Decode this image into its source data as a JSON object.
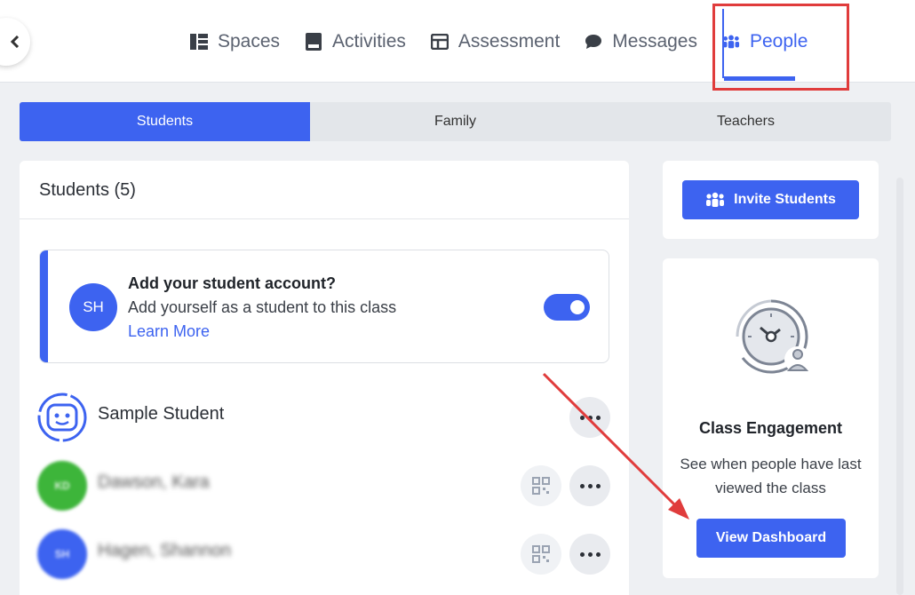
{
  "nav": {
    "items": [
      {
        "label": "Spaces",
        "icon": "spaces-icon"
      },
      {
        "label": "Activities",
        "icon": "activities-icon"
      },
      {
        "label": "Assessment",
        "icon": "assessment-icon"
      },
      {
        "label": "Messages",
        "icon": "messages-icon"
      },
      {
        "label": "People",
        "icon": "people-icon"
      }
    ],
    "active": "People"
  },
  "tabs": [
    {
      "label": "Students"
    },
    {
      "label": "Family"
    },
    {
      "label": "Teachers"
    }
  ],
  "students_card": {
    "title": "Students (5)",
    "add_account": {
      "avatar": "SH",
      "title": "Add your student account?",
      "subtitle": "Add yourself as a student to this class",
      "link": "Learn More",
      "toggle_on": true
    },
    "rows": [
      {
        "name": "Sample Student",
        "avatar": "robot-avatar"
      },
      {
        "name": "Dawson, Kara",
        "initials": "KD",
        "color": "#3db53a"
      },
      {
        "name": "Hagen, Shannon",
        "initials": "SH",
        "color": "#3d63f0"
      }
    ]
  },
  "invite": {
    "label": "Invite Students"
  },
  "engagement": {
    "title": "Class Engagement",
    "text": "See when people have last viewed the class",
    "button": "View Dashboard"
  },
  "colors": {
    "accent": "#3d63f0",
    "annotation": "#e03c3c"
  }
}
